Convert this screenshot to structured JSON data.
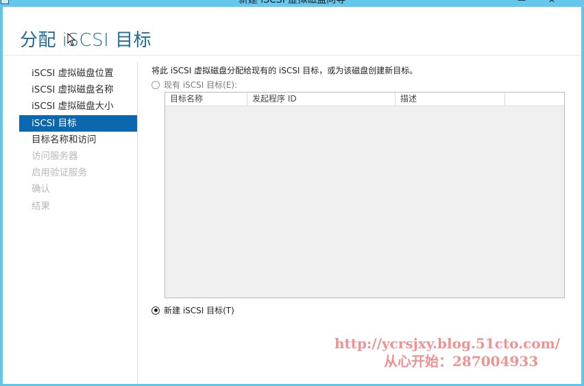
{
  "window": {
    "title": "新建 iSCSI 虚拟磁盘向导",
    "minimize_glyph": "—",
    "close_glyph": "✕"
  },
  "page": {
    "title": "分配 iSCSI 目标"
  },
  "nav": {
    "items": [
      {
        "label": "iSCSI 虚拟磁盘位置",
        "state": "normal"
      },
      {
        "label": "iSCSI 虚拟磁盘名称",
        "state": "normal"
      },
      {
        "label": "iSCSI 虚拟磁盘大小",
        "state": "normal"
      },
      {
        "label": "iSCSI 目标",
        "state": "active"
      },
      {
        "label": "目标名称和访问",
        "state": "normal"
      },
      {
        "label": "访问服务器",
        "state": "disabled"
      },
      {
        "label": "启用验证服务",
        "state": "disabled"
      },
      {
        "label": "确认",
        "state": "disabled"
      },
      {
        "label": "结果",
        "state": "disabled"
      }
    ]
  },
  "content": {
    "description": "将此 iSCSI 虚拟磁盘分配给现有的 iSCSI 目标，或为该磁盘创建新目标。",
    "existing_option": {
      "label": "现有 iSCSI 目标(E):",
      "selected": false
    },
    "table": {
      "columns": [
        "目标名称",
        "发起程序 ID",
        "描述",
        ""
      ],
      "rows": []
    },
    "new_option": {
      "label": "新建 iSCSI 目标(T)",
      "selected": true
    }
  },
  "watermark": {
    "line1": "http://ycrsjxy.blog.51cto.com/",
    "line2": "从心开始：287004933"
  },
  "colors": {
    "titlebar": "#63c8ec",
    "accent": "#0b68ae",
    "title_text": "#1e6a9a",
    "disabled_text": "#b8b8b8"
  }
}
